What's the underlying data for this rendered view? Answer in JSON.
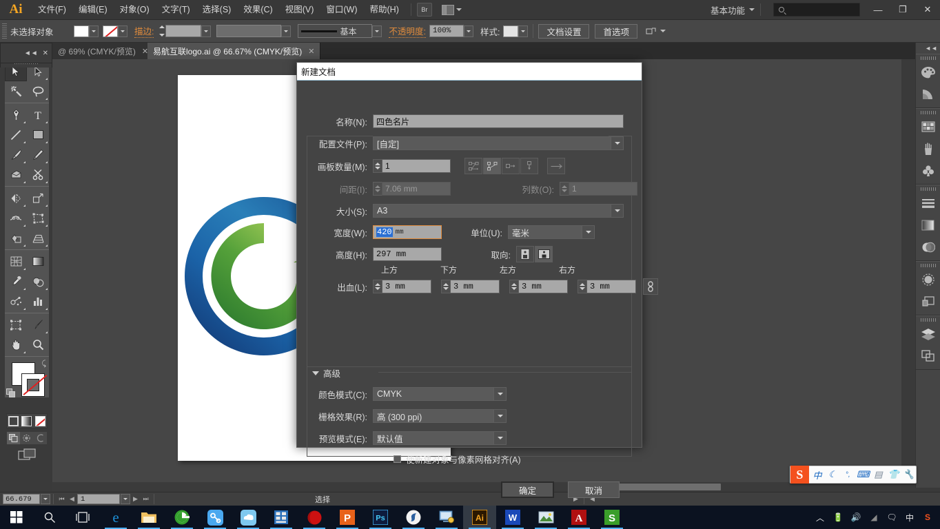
{
  "app": {
    "logo": "Ai",
    "menus": [
      "文件(F)",
      "编辑(E)",
      "对象(O)",
      "文字(T)",
      "选择(S)",
      "效果(C)",
      "视图(V)",
      "窗口(W)",
      "帮助(H)"
    ],
    "bridge_label": "Br",
    "workspace": "基本功能",
    "search_placeholder": "",
    "window_buttons": {
      "minimize": "—",
      "restore": "❐",
      "close": "✕"
    }
  },
  "control_bar": {
    "selection_status": "未选择对象",
    "stroke_label": "描边:",
    "stroke_weight": "",
    "stroke_profile": "基本",
    "opacity_label": "不透明度:",
    "opacity_value": "100%",
    "style_label": "样式:",
    "doc_setup_button": "文档设置",
    "preferences_button": "首选项"
  },
  "tabs": [
    {
      "label": "@ 69% (CMYK/预览)",
      "close": "✕",
      "active": false
    },
    {
      "label": "易航互联logo.ai @ 66.67% (CMYK/预览)",
      "close": "✕",
      "active": true
    }
  ],
  "toolbar": {
    "tools": [
      "selection-tool",
      "direct-selection-tool",
      "magic-wand-tool",
      "lasso-tool",
      "pen-tool",
      "type-tool",
      "line-segment-tool",
      "rectangle-tool",
      "paintbrush-tool",
      "pencil-tool",
      "blob-brush-tool",
      "scissors-tool",
      "rotate-tool",
      "scale-tool",
      "width-tool",
      "free-transform-tool",
      "shape-builder-tool",
      "perspective-grid-tool",
      "mesh-tool",
      "gradient-tool",
      "eyedropper-tool",
      "blend-tool",
      "symbol-sprayer-tool",
      "column-graph-tool",
      "artboard-tool",
      "slice-tool",
      "hand-tool",
      "zoom-tool"
    ],
    "fill_color": "#ffffff",
    "stroke_color": "#ffffff",
    "modes": [
      "color-mode",
      "gradient-mode",
      "none-mode"
    ],
    "draw_modes": [
      "draw-normal",
      "draw-behind",
      "draw-inside"
    ],
    "screen_mode": "change-screen-mode"
  },
  "right_dock": {
    "collapse": "◄◄",
    "panels": [
      "color-panel",
      "color-guide-panel",
      "swatches-panel",
      "brushes-panel",
      "symbols-panel",
      "stroke-panel",
      "gradient-panel",
      "transparency-panel",
      "appearance-panel",
      "graphic-styles-panel",
      "layers-panel",
      "artboards-panel"
    ]
  },
  "dialog": {
    "title": "新建文档",
    "fields": {
      "name_label": "名称(N):",
      "name_value": "四色名片",
      "profile_label": "配置文件(P):",
      "profile_value": "[自定]",
      "artboards_label": "画板数量(M):",
      "artboards_value": "1",
      "spacing_label": "间距(I):",
      "spacing_value": "7.06 mm",
      "columns_label": "列数(O):",
      "columns_value": "1",
      "size_label": "大小(S):",
      "size_value": "A3",
      "width_label": "宽度(W):",
      "width_value": "420",
      "width_unit": "mm",
      "units_label": "单位(U):",
      "units_value": "毫米",
      "height_label": "高度(H):",
      "height_value": "297 mm",
      "orientation_label": "取向:",
      "bleed_label": "出血(L):",
      "bleed_top_label": "上方",
      "bleed_bottom_label": "下方",
      "bleed_left_label": "左方",
      "bleed_right_label": "右方",
      "bleed_top": "3 mm",
      "bleed_bottom": "3 mm",
      "bleed_left": "3 mm",
      "bleed_right": "3 mm",
      "advanced_label": "高级",
      "color_mode_label": "颜色模式(C):",
      "color_mode_value": "CMYK",
      "raster_label": "栅格效果(R):",
      "raster_value": "高 (300 ppi)",
      "preview_label": "预览模式(E):",
      "preview_value": "默认值",
      "align_pixel_label": "使新建对象与像素网格对齐(A)"
    },
    "buttons": {
      "ok": "确定",
      "cancel": "取消"
    },
    "artboard_layout_icons": [
      "grid-by-row",
      "grid-by-column",
      "arrange-by-row",
      "arrange-by-column",
      "change-direction"
    ],
    "orientation_icons": [
      "portrait-orientation",
      "landscape-orientation"
    ],
    "bleed_link_icon": "link-bleed-values"
  },
  "status_bar": {
    "zoom": "66.679",
    "page": "1",
    "tool_status": "选择"
  },
  "taskbar": {
    "start": "windows-start",
    "items": [
      "search-icon",
      "task-view-icon",
      "edge-icon",
      "file-explorer-icon",
      "ie-browser-icon",
      "baidu-netdisk-icon",
      "cloud-icon",
      "video-editor-icon",
      "red-app-icon",
      "wps-presentation-icon",
      "photoshop-icon",
      "sogou-icon",
      "remote-desktop-icon",
      "illustrator-icon",
      "wps-writer-icon",
      "photo-viewer-icon",
      "acrobat-icon",
      "wps-spreadsheet-icon"
    ],
    "tray": [
      "show-hidden-icons",
      "battery-icon",
      "volume-icon",
      "network-icon",
      "action-center-icon",
      "ime-cn-icon",
      "sogou-tray-icon"
    ]
  },
  "ime_bar": {
    "logo": "S",
    "mode": "中",
    "icons": [
      "moon-icon",
      "punctuation-icon",
      "keyboard-icon",
      "user-icon",
      "skin-icon",
      "tools-icon"
    ]
  },
  "logo_art": {
    "blue": "#1b5ea8",
    "green": "#5aa83c",
    "light_green": "#8cc63f"
  }
}
